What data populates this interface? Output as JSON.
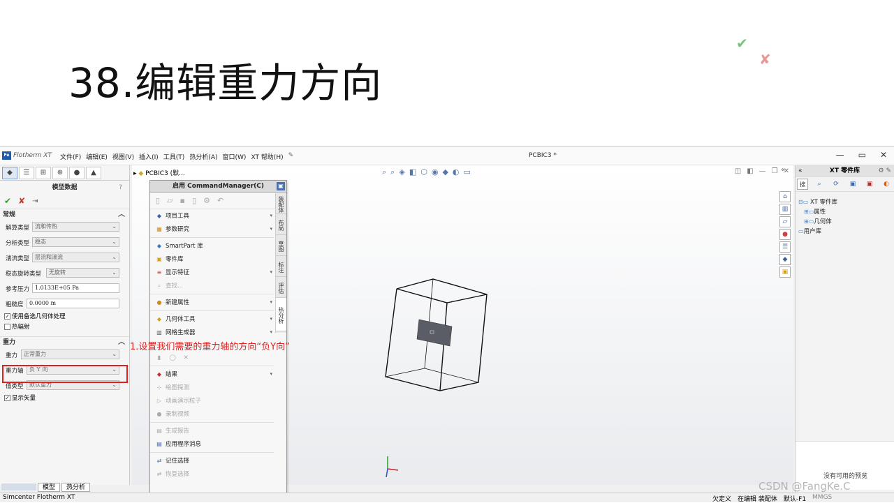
{
  "slide": {
    "title": "38.编辑重力方向"
  },
  "app": {
    "logo_text": "Flotherm XT",
    "logo_badge": "Fe",
    "menu": [
      "文件(F)",
      "编辑(E)",
      "视图(V)",
      "插入(I)",
      "工具(T)",
      "热分析(A)",
      "窗口(W)",
      "XT 帮助(H)"
    ],
    "doc_title": "PCBIC3 *",
    "window_buttons": [
      "—",
      "▭",
      "✕"
    ]
  },
  "left_panel": {
    "heading": "模型数据",
    "help": "?",
    "section_general": "常规",
    "rows": [
      {
        "label": "解算类型",
        "value": "流和传热"
      },
      {
        "label": "分析类型",
        "value": "稳态"
      },
      {
        "label": "湍流类型",
        "value": "层流和湍流"
      },
      {
        "label": "稳态旋转类型",
        "value": "无旋转"
      },
      {
        "label": "参考压力",
        "value": "1.0133E+05 Pa"
      },
      {
        "label": "粗糙度",
        "value": "0.0000 m"
      }
    ],
    "checkbox_alt_geometry": "使用备选几何体处理",
    "checkbox_radiation": "热辐射",
    "section_gravity": "重力",
    "gravity_rows": [
      {
        "label": "重力",
        "value": "正常重力"
      },
      {
        "label": "重力轴",
        "value": "负 Y 向"
      },
      {
        "label": "值类型",
        "value": "默认重力"
      }
    ],
    "checkbox_show_vector": "显示矢量"
  },
  "tree": {
    "root": "PCBIC3  (默..."
  },
  "command_manager": {
    "title": "启用 CommandManager(C)",
    "items": [
      {
        "label": "项目工具",
        "enabled": true,
        "submenu": true
      },
      {
        "label": "参数研究",
        "enabled": true,
        "submenu": true
      },
      {
        "label": "SmartPart 库",
        "enabled": true,
        "submenu": false
      },
      {
        "label": "零件库",
        "enabled": true,
        "submenu": false
      },
      {
        "label": "显示特征",
        "enabled": true,
        "submenu": true
      },
      {
        "label": "查找...",
        "enabled": false,
        "submenu": false
      },
      {
        "label": "新建属性",
        "enabled": true,
        "submenu": true
      },
      {
        "label": "几何体工具",
        "enabled": true,
        "submenu": true
      },
      {
        "label": "网格生成器",
        "enabled": true,
        "submenu": true
      },
      {
        "label": "结果",
        "enabled": true,
        "submenu": true
      },
      {
        "label": "绘图探测",
        "enabled": false,
        "submenu": false
      },
      {
        "label": "动画演示粒子",
        "enabled": false,
        "submenu": false
      },
      {
        "label": "录制视频",
        "enabled": false,
        "submenu": false
      },
      {
        "label": "生成报告",
        "enabled": false,
        "submenu": false
      },
      {
        "label": "应用程序消息",
        "enabled": true,
        "submenu": false
      },
      {
        "label": "记住选择",
        "enabled": true,
        "submenu": false
      },
      {
        "label": "恢复选择",
        "enabled": false,
        "submenu": false
      }
    ],
    "side_tabs": [
      "装配体",
      "布局",
      "草图",
      "标注",
      "评估",
      "热分析"
    ]
  },
  "annotation": "1.设置我们需要的重力轴的方向“负Y向”",
  "right_panel": {
    "title": "XT 零件库",
    "search_label": "搜",
    "tree": [
      "XT 零件库",
      "属性",
      "几何体",
      "用户库"
    ],
    "preview_text": "没有可用的预览"
  },
  "sheet_tabs": [
    "模型",
    "热分析"
  ],
  "status": {
    "app_name": "Simcenter Flotherm XT",
    "right": [
      "欠定义",
      "在编辑 装配体",
      "默认-F1",
      "MMGS"
    ]
  },
  "watermark": "CSDN @FangKe.C",
  "colors": {
    "annotation": "#e02020",
    "accent": "#1e5aa8"
  }
}
